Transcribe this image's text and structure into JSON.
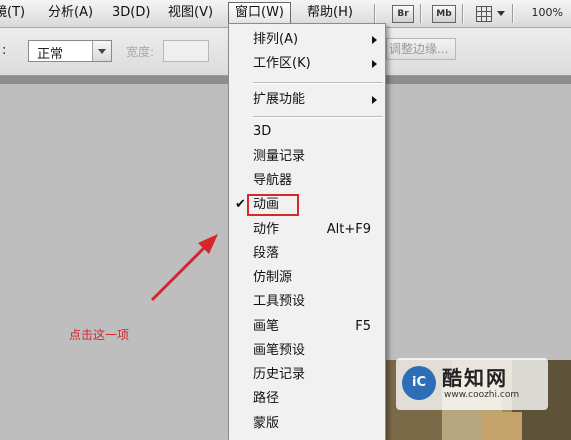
{
  "menubar": {
    "items": [
      "镜(T)",
      "分析(A)",
      "3D(D)",
      "视图(V)",
      "窗口(W)",
      "帮助(H)"
    ],
    "app_buttons": [
      "Br",
      "Mb"
    ],
    "zoom": "100%"
  },
  "options_bar": {
    "mode_value": "正常",
    "width_label": "宽度:",
    "refine_button": "调整边缘..."
  },
  "window_menu": {
    "items": [
      {
        "label": "排列(A)",
        "submenu": true
      },
      {
        "label": "工作区(K)",
        "submenu": true
      },
      {
        "label": "扩展功能",
        "submenu": true
      },
      {
        "label": "3D"
      },
      {
        "label": "测量记录"
      },
      {
        "label": "导航器"
      },
      {
        "label": "动画",
        "checked": true,
        "highlighted": true
      },
      {
        "label": "动作",
        "shortcut": "Alt+F9"
      },
      {
        "label": "段落"
      },
      {
        "label": "仿制源"
      },
      {
        "label": "工具预设"
      },
      {
        "label": "画笔",
        "shortcut": "F5"
      },
      {
        "label": "画笔预设"
      },
      {
        "label": "历史记录"
      },
      {
        "label": "路径"
      },
      {
        "label": "蒙版"
      }
    ]
  },
  "annotation": {
    "text": "点击这一项",
    "color": "#d8242b"
  },
  "watermark": {
    "logo_letters": "iC",
    "name": "酷知网",
    "url": "www.coozhi.com"
  },
  "icons": {
    "check": "✔"
  }
}
